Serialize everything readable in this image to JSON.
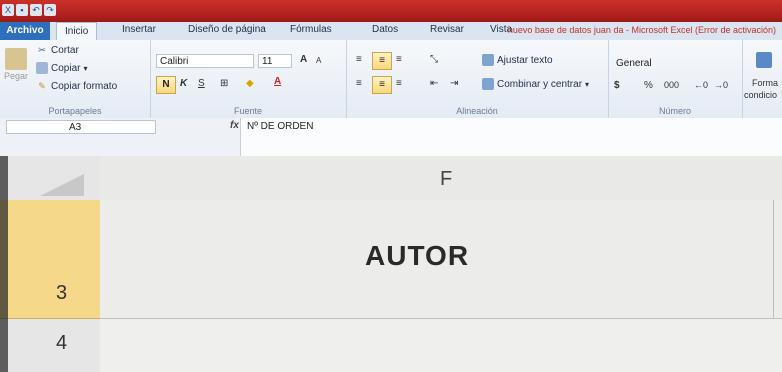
{
  "window": {
    "title": "nuevo base de datos juan da - Microsoft Excel (Error de activación)"
  },
  "tabs": {
    "file": "Archivo",
    "items": [
      "Inicio",
      "Insertar",
      "Diseño de página",
      "Fórmulas",
      "Datos",
      "Revisar",
      "Vista"
    ]
  },
  "clipboard": {
    "paste": "Pegar",
    "cut": "Cortar",
    "copy": "Copiar",
    "format_painter": "Copiar formato",
    "label": "Portapapeles"
  },
  "font": {
    "name": "Calibri",
    "size": "11",
    "grow": "A",
    "shrink": "A",
    "bold": "N",
    "italic": "K",
    "underline": "S",
    "label": "Fuente"
  },
  "alignment": {
    "wrap_text": "Ajustar texto",
    "merge_center": "Combinar y centrar",
    "label": "Alineación"
  },
  "number": {
    "format": "General",
    "currency": "$",
    "percent": "%",
    "thousands": "000",
    "label": "Número"
  },
  "styles": {
    "conditional_1": "Forma",
    "conditional_2": "condicio"
  },
  "formula_bar": {
    "name_box": "A3",
    "fx": "fx",
    "content": "Nº DE ORDEN"
  },
  "sheet": {
    "column_header": "F",
    "row3": "3",
    "row4": "4",
    "cell_value": "AUTOR"
  },
  "colors": {
    "title_bar": "#b0201c",
    "file_tab": "#2d6fbd",
    "selected_row_header": "#f5d88a"
  }
}
